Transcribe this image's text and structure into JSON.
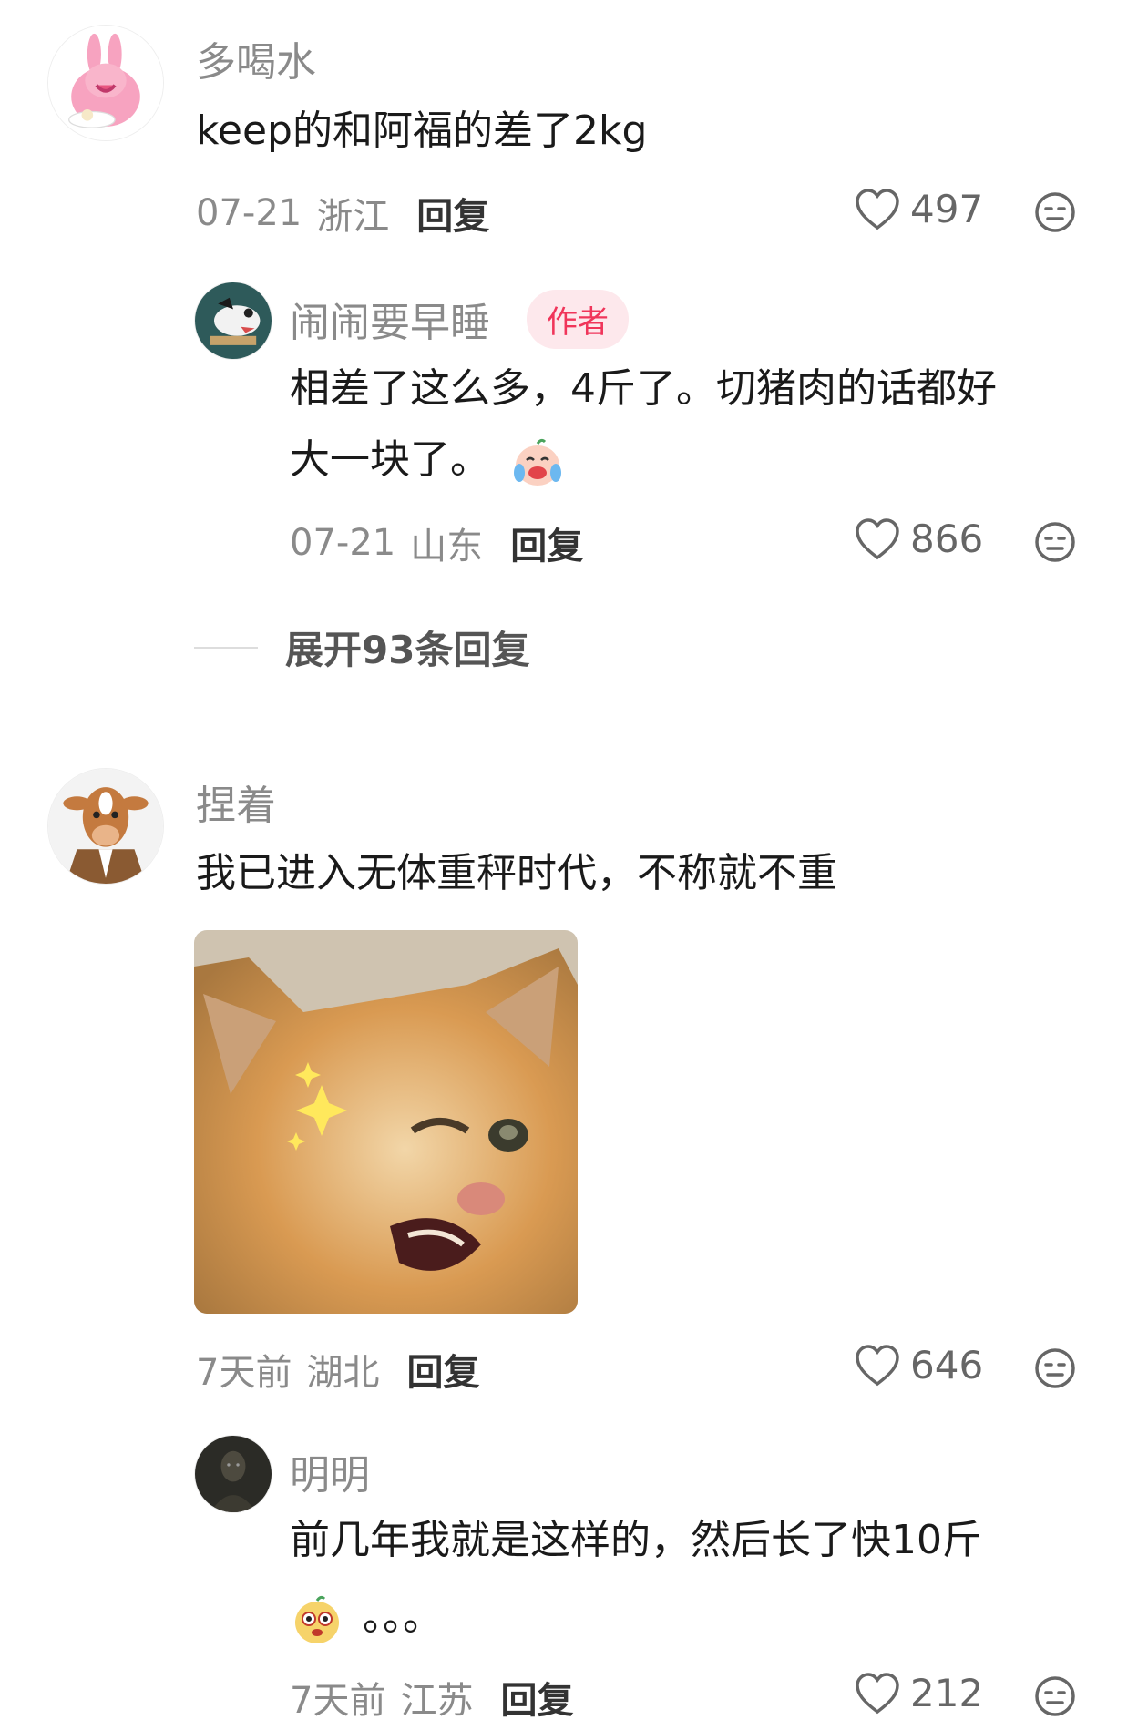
{
  "comments": [
    {
      "username": "多喝水",
      "text": "keep的和阿福的差了2kg",
      "date": "07-21",
      "location": "浙江",
      "reply_label": "回复",
      "likes": "497",
      "avatar": "pink-bunny-avatar",
      "replies": [
        {
          "username": "闹闹要早睡",
          "badge": "作者",
          "text_line1": "相差了这么多，4斤了。切猪肉的话都好",
          "text_line2": "大一块了。",
          "date": "07-21",
          "location": "山东",
          "reply_label": "回复",
          "likes": "866",
          "avatar": "dog-cartoon-avatar",
          "emoji": "crying-laugh-emoji"
        }
      ],
      "expand_label": "展开93条回复"
    },
    {
      "username": "捏着",
      "text": "我已进入无体重秤时代，不称就不重",
      "date": "7天前",
      "location": "湖北",
      "reply_label": "回复",
      "likes": "646",
      "avatar": "cow-in-suit-avatar",
      "image": "winking-cat-meme",
      "replies": [
        {
          "username": "明明",
          "text_line1": "前几年我就是这样的，然后长了快10斤",
          "text_line2": "。。。",
          "date": "7天前",
          "location": "江苏",
          "reply_label": "回复",
          "likes": "212",
          "avatar": "dark-portrait-avatar",
          "emoji": "funny-face-emoji"
        }
      ]
    }
  ],
  "icons": {
    "like": "heart-outline-icon",
    "dislike": "meh-face-icon"
  },
  "colors": {
    "author_badge_bg": "#fde8ec",
    "author_badge_text": "#f0355a",
    "meta_gray": "#8a8a8a"
  }
}
